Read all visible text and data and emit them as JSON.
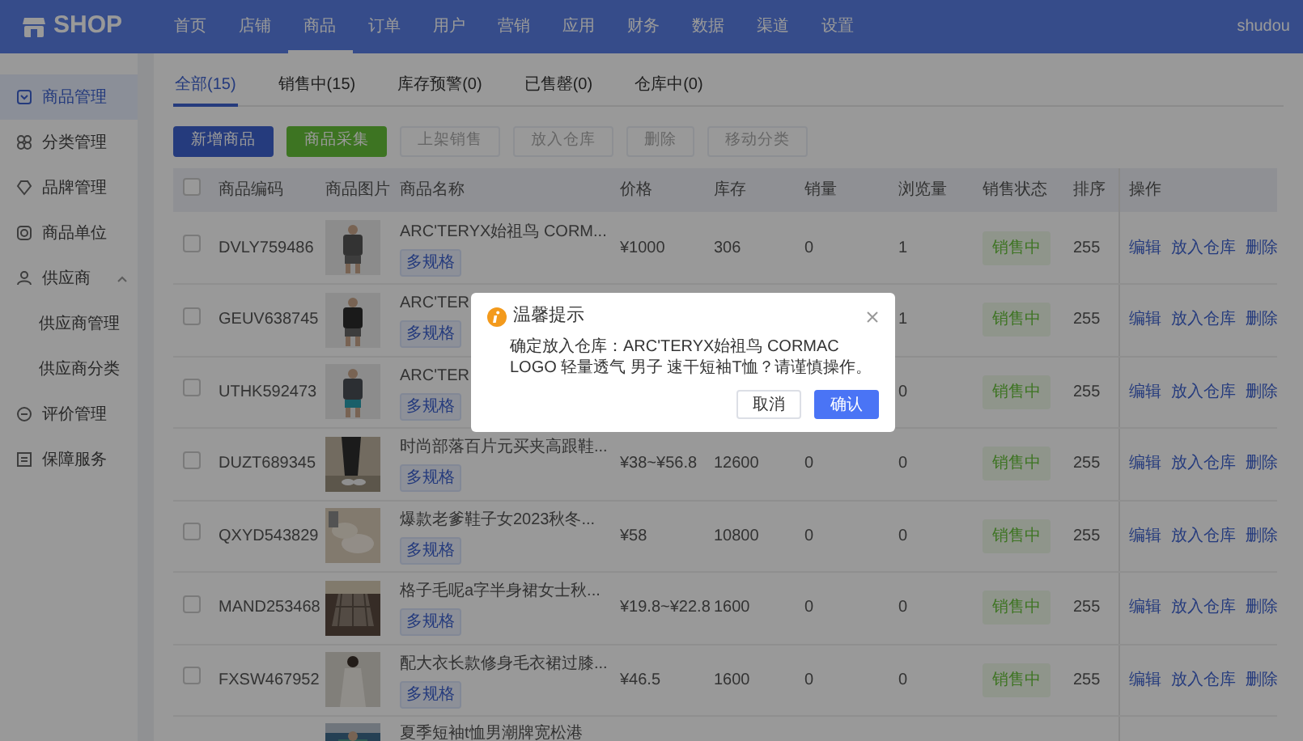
{
  "navbar": {
    "brand": "SHOP",
    "user": "shudou",
    "items": [
      {
        "label": "首页",
        "selected": false
      },
      {
        "label": "店铺",
        "selected": false
      },
      {
        "label": "商品",
        "selected": true
      },
      {
        "label": "订单",
        "selected": false
      },
      {
        "label": "用户",
        "selected": false
      },
      {
        "label": "营销",
        "selected": false
      },
      {
        "label": "应用",
        "selected": false
      },
      {
        "label": "财务",
        "selected": false
      },
      {
        "label": "数据",
        "selected": false
      },
      {
        "label": "渠道",
        "selected": false
      },
      {
        "label": "设置",
        "selected": false
      }
    ]
  },
  "sidebar": {
    "items": [
      {
        "label": "商品管理",
        "selected": true
      },
      {
        "label": "分类管理",
        "selected": false
      },
      {
        "label": "品牌管理",
        "selected": false
      },
      {
        "label": "商品单位",
        "selected": false
      },
      {
        "label": "供应商",
        "selected": false,
        "expanded": true,
        "children": [
          {
            "label": "供应商管理",
            "selected": false
          },
          {
            "label": "供应商分类",
            "selected": false
          }
        ]
      },
      {
        "label": "评价管理",
        "selected": false
      },
      {
        "label": "保障服务",
        "selected": false
      }
    ]
  },
  "tabs": [
    {
      "label": "全部(15)",
      "selected": true
    },
    {
      "label": "销售中(15)",
      "selected": false
    },
    {
      "label": "库存预警(0)",
      "selected": false
    },
    {
      "label": "已售罄(0)",
      "selected": false
    },
    {
      "label": "仓库中(0)",
      "selected": false
    }
  ],
  "toolbar": [
    {
      "label": "新增商品",
      "kind": "primary",
      "disabled": false
    },
    {
      "label": "商品采集",
      "kind": "success",
      "disabled": false
    },
    {
      "label": "上架销售",
      "kind": "plain",
      "disabled": true
    },
    {
      "label": "放入仓库",
      "kind": "plain",
      "disabled": true
    },
    {
      "label": "删除",
      "kind": "plain",
      "disabled": true
    },
    {
      "label": "移动分类",
      "kind": "plain",
      "disabled": true
    }
  ],
  "table": {
    "header_checked": false,
    "columns": [
      "商品编码",
      "商品图片",
      "商品名称",
      "价格",
      "库存",
      "销量",
      "浏览量",
      "销售状态",
      "排序",
      "操作"
    ],
    "rows": [
      {
        "checked": false,
        "code": "DVLY759486",
        "name": "ARC'TERYX始祖鸟 CORM...",
        "tag": "多规格",
        "price": "¥1000",
        "stock": "306",
        "sales": "0",
        "views": "1",
        "status": "销售中",
        "sort": "255",
        "actions": [
          "编辑",
          "放入仓库",
          "删除"
        ]
      },
      {
        "checked": false,
        "code": "GEUV638745",
        "name": "ARC'TER",
        "tag": "多规格",
        "views": "1",
        "status": "销售中",
        "sort": "255",
        "actions": [
          "编辑",
          "放入仓库",
          "删除"
        ]
      },
      {
        "checked": false,
        "code": "UTHK592473",
        "name": "ARC'TER",
        "tag": "多规格",
        "views": "0",
        "status": "销售中",
        "sort": "255",
        "actions": [
          "编辑",
          "放入仓库",
          "删除"
        ]
      },
      {
        "checked": false,
        "code": "DUZT689345",
        "name": "时尚部落百片元买夹高跟鞋...",
        "tag": "多规格",
        "price": "¥38~¥56.8",
        "stock": "12600",
        "sales": "0",
        "views": "0",
        "status": "销售中",
        "sort": "255",
        "actions": [
          "编辑",
          "放入仓库",
          "删除"
        ]
      },
      {
        "checked": false,
        "code": "QXYD543829",
        "name": "爆款老爹鞋子女2023秋冬...",
        "tag": "多规格",
        "price": "¥58",
        "stock": "10800",
        "sales": "0",
        "views": "0",
        "status": "销售中",
        "sort": "255",
        "actions": [
          "编辑",
          "放入仓库",
          "删除"
        ]
      },
      {
        "checked": false,
        "code": "MAND253468",
        "name": "格子毛呢a字半身裙女士秋...",
        "tag": "多规格",
        "price": "¥19.8~¥22.8",
        "stock": "1600",
        "sales": "0",
        "views": "0",
        "status": "销售中",
        "sort": "255",
        "actions": [
          "编辑",
          "放入仓库",
          "删除"
        ]
      },
      {
        "checked": false,
        "code": "FXSW467952",
        "name": "配大衣长款修身毛衣裙过膝...",
        "tag": "多规格",
        "price": "¥46.5",
        "stock": "1600",
        "sales": "0",
        "views": "0",
        "status": "销售中",
        "sort": "255",
        "actions": [
          "编辑",
          "放入仓库",
          "删除"
        ]
      },
      {
        "name": "夏季短袖t恤男潮牌宽松港"
      }
    ]
  },
  "dialog": {
    "title": "温馨提示",
    "message": "确定放入仓库：ARC'TERYX始祖鸟 CORMAC LOGO 轻量透气 男子 速干短袖T恤？请谨慎操作。",
    "buttons": [
      {
        "label": "取消",
        "kind": "plain"
      },
      {
        "label": "确认",
        "kind": "primary"
      }
    ]
  }
}
